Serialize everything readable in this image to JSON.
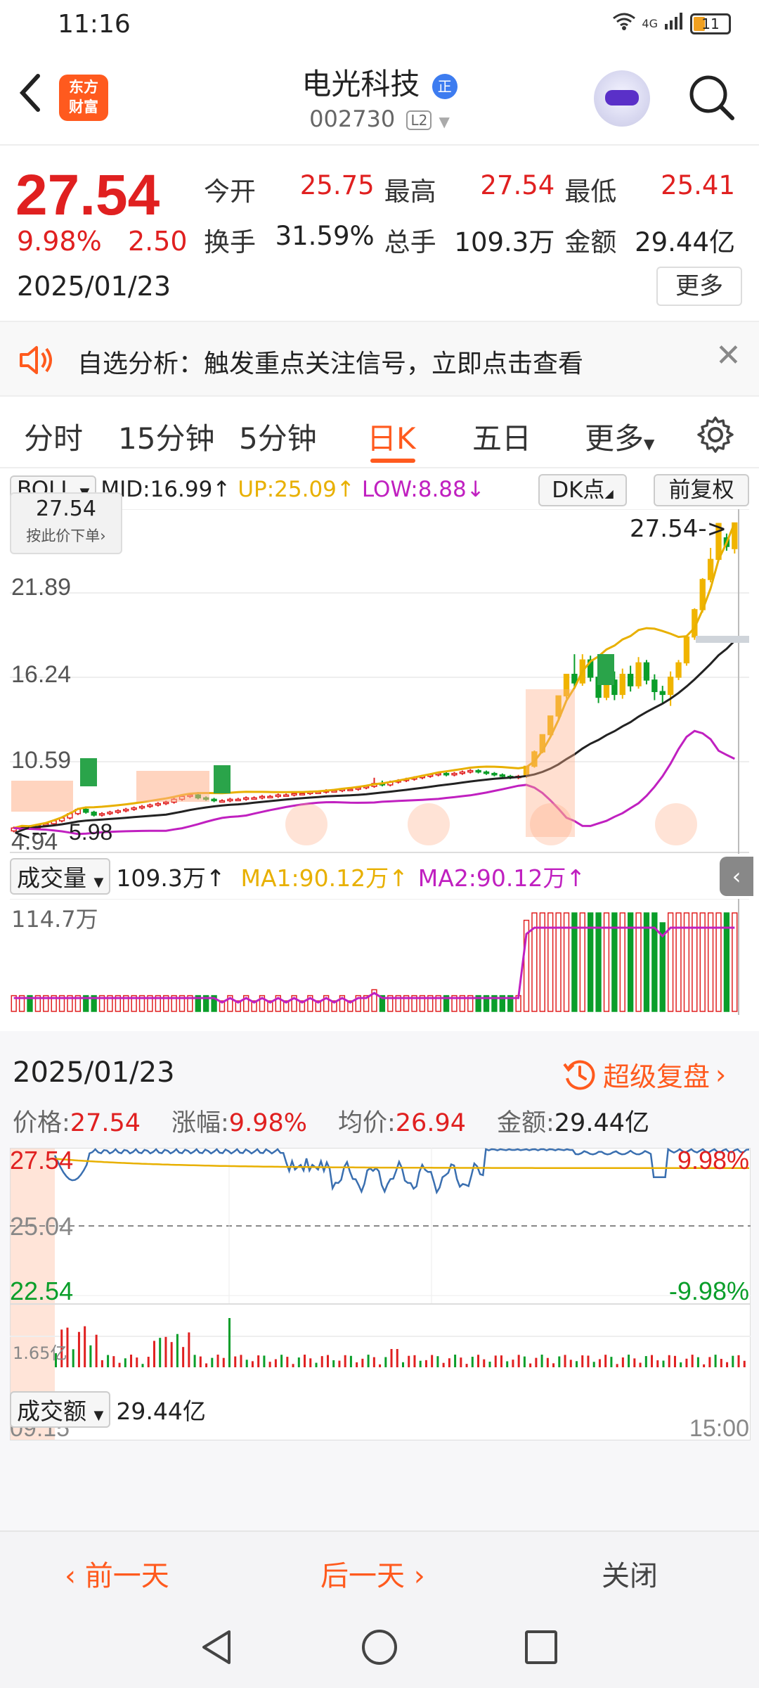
{
  "status_bar": {
    "time": "11:16",
    "network": "4G",
    "battery": "11"
  },
  "header": {
    "name": "电光科技",
    "badge": "正",
    "code": "002730",
    "level": "L2",
    "logo_line1": "东方",
    "logo_line2": "财富"
  },
  "quote": {
    "price": "27.54",
    "change_pct": "9.98%",
    "change": "2.50",
    "date": "2025/01/23",
    "fields": [
      {
        "label": "今开",
        "value": "25.75",
        "color": "#e02020"
      },
      {
        "label": "最高",
        "value": "27.54",
        "color": "#e02020"
      },
      {
        "label": "最低",
        "value": "25.41",
        "color": "#e02020"
      },
      {
        "label": "换手",
        "value": "31.59%",
        "color": "#222222"
      },
      {
        "label": "总手",
        "value": "109.3万",
        "color": "#222222"
      },
      {
        "label": "金额",
        "value": "29.44亿",
        "color": "#222222"
      }
    ],
    "more": "更多"
  },
  "banner": {
    "text": "自选分析：触发重点关注信号，立即点击查看"
  },
  "tabs": {
    "items": [
      "分时",
      "15分钟",
      "5分钟",
      "日K",
      "五日",
      "更多"
    ],
    "active": "日K"
  },
  "indicator": {
    "name": "BOLL",
    "mid": "MID:16.99↑",
    "up": "UP:25.09↑",
    "low": "LOW:8.88↓",
    "dk": "DK点",
    "adj": "前复权"
  },
  "kchart": {
    "tip_price": "27.54",
    "tip_sub": "按此价下单",
    "last_label": "27.54->",
    "y_labels": [
      "21.89",
      "16.24",
      "10.59",
      "4.94"
    ],
    "low_label": "5.98",
    "colors": {
      "up": "#e02020",
      "yellow": "#f0b400",
      "green": "#0a9e2a",
      "mid": "#222222",
      "band": "#c020c0"
    },
    "candles": [
      {
        "o": 6.1,
        "c": 6.3,
        "h": 6.4,
        "l": 6.0
      },
      {
        "o": 6.2,
        "c": 6.4,
        "h": 6.5,
        "l": 6.1
      },
      {
        "o": 6.4,
        "c": 6.3,
        "h": 6.5,
        "l": 6.2
      },
      {
        "o": 6.3,
        "c": 6.5,
        "h": 6.6,
        "l": 6.2
      },
      {
        "o": 6.5,
        "c": 6.6,
        "h": 6.7,
        "l": 6.4
      },
      {
        "o": 6.6,
        "c": 6.8,
        "h": 6.9,
        "l": 6.5
      },
      {
        "o": 6.8,
        "c": 7.0,
        "h": 7.1,
        "l": 6.7
      },
      {
        "o": 7.0,
        "c": 7.3,
        "h": 7.4,
        "l": 6.9
      },
      {
        "o": 7.3,
        "c": 7.6,
        "h": 7.7,
        "l": 7.2
      },
      {
        "o": 7.6,
        "c": 7.4,
        "h": 7.8,
        "l": 7.3
      },
      {
        "o": 7.4,
        "c": 7.2,
        "h": 7.5,
        "l": 7.1
      },
      {
        "o": 7.2,
        "c": 7.3,
        "h": 7.4,
        "l": 7.1
      },
      {
        "o": 7.3,
        "c": 7.4,
        "h": 7.5,
        "l": 7.2
      },
      {
        "o": 7.4,
        "c": 7.5,
        "h": 7.6,
        "l": 7.3
      },
      {
        "o": 7.5,
        "c": 7.6,
        "h": 7.7,
        "l": 7.4
      },
      {
        "o": 7.6,
        "c": 7.7,
        "h": 7.8,
        "l": 7.5
      },
      {
        "o": 7.7,
        "c": 7.8,
        "h": 7.9,
        "l": 7.6
      },
      {
        "o": 7.8,
        "c": 7.9,
        "h": 8.0,
        "l": 7.7
      },
      {
        "o": 7.9,
        "c": 8.0,
        "h": 8.1,
        "l": 7.8
      },
      {
        "o": 8.0,
        "c": 8.1,
        "h": 8.2,
        "l": 7.9
      },
      {
        "o": 8.1,
        "c": 8.3,
        "h": 8.4,
        "l": 8.0
      },
      {
        "o": 8.3,
        "c": 8.5,
        "h": 8.6,
        "l": 8.2
      },
      {
        "o": 8.5,
        "c": 8.6,
        "h": 8.7,
        "l": 8.4
      },
      {
        "o": 8.6,
        "c": 8.4,
        "h": 8.8,
        "l": 8.3
      },
      {
        "o": 8.4,
        "c": 8.3,
        "h": 8.5,
        "l": 8.2
      },
      {
        "o": 8.3,
        "c": 8.2,
        "h": 8.4,
        "l": 8.1
      },
      {
        "o": 8.2,
        "c": 8.2,
        "h": 8.3,
        "l": 8.1
      },
      {
        "o": 8.2,
        "c": 8.3,
        "h": 8.4,
        "l": 8.1
      },
      {
        "o": 8.3,
        "c": 8.3,
        "h": 8.4,
        "l": 8.2
      },
      {
        "o": 8.3,
        "c": 8.4,
        "h": 8.5,
        "l": 8.2
      },
      {
        "o": 8.4,
        "c": 8.4,
        "h": 8.5,
        "l": 8.3
      },
      {
        "o": 8.4,
        "c": 8.5,
        "h": 8.6,
        "l": 8.3
      },
      {
        "o": 8.5,
        "c": 8.5,
        "h": 8.6,
        "l": 8.4
      },
      {
        "o": 8.5,
        "c": 8.6,
        "h": 8.7,
        "l": 8.4
      },
      {
        "o": 8.6,
        "c": 8.6,
        "h": 8.7,
        "l": 8.5
      },
      {
        "o": 8.6,
        "c": 8.7,
        "h": 8.8,
        "l": 8.5
      },
      {
        "o": 8.7,
        "c": 8.7,
        "h": 8.8,
        "l": 8.6
      },
      {
        "o": 8.7,
        "c": 8.8,
        "h": 8.9,
        "l": 8.6
      },
      {
        "o": 8.8,
        "c": 8.8,
        "h": 8.9,
        "l": 8.7
      },
      {
        "o": 8.8,
        "c": 8.9,
        "h": 9.0,
        "l": 8.7
      },
      {
        "o": 8.9,
        "c": 8.9,
        "h": 9.0,
        "l": 8.8
      },
      {
        "o": 8.9,
        "c": 9.0,
        "h": 9.1,
        "l": 8.8
      },
      {
        "o": 9.0,
        "c": 9.0,
        "h": 9.1,
        "l": 8.9
      },
      {
        "o": 9.0,
        "c": 9.1,
        "h": 9.2,
        "l": 8.9
      },
      {
        "o": 9.1,
        "c": 9.2,
        "h": 9.3,
        "l": 9.0
      },
      {
        "o": 9.2,
        "c": 9.4,
        "h": 9.8,
        "l": 9.1
      },
      {
        "o": 9.4,
        "c": 9.3,
        "h": 9.6,
        "l": 9.2
      },
      {
        "o": 9.3,
        "c": 9.5,
        "h": 9.6,
        "l": 9.2
      },
      {
        "o": 9.5,
        "c": 9.6,
        "h": 9.7,
        "l": 9.4
      },
      {
        "o": 9.6,
        "c": 9.7,
        "h": 9.8,
        "l": 9.5
      },
      {
        "o": 9.7,
        "c": 9.8,
        "h": 9.9,
        "l": 9.6
      },
      {
        "o": 9.8,
        "c": 9.9,
        "h": 10.0,
        "l": 9.7
      },
      {
        "o": 9.9,
        "c": 10.0,
        "h": 10.1,
        "l": 9.8
      },
      {
        "o": 10.0,
        "c": 10.1,
        "h": 10.2,
        "l": 9.9
      },
      {
        "o": 10.1,
        "c": 10.0,
        "h": 10.2,
        "l": 9.9
      },
      {
        "o": 10.0,
        "c": 10.1,
        "h": 10.2,
        "l": 9.9
      },
      {
        "o": 10.1,
        "c": 10.2,
        "h": 10.3,
        "l": 10.0
      },
      {
        "o": 10.2,
        "c": 10.3,
        "h": 10.4,
        "l": 10.1
      },
      {
        "o": 10.3,
        "c": 10.2,
        "h": 10.4,
        "l": 10.1
      },
      {
        "o": 10.2,
        "c": 10.1,
        "h": 10.3,
        "l": 10.0
      },
      {
        "o": 10.1,
        "c": 10.0,
        "h": 10.2,
        "l": 9.9
      },
      {
        "o": 10.0,
        "c": 9.9,
        "h": 10.1,
        "l": 9.8
      },
      {
        "o": 9.9,
        "c": 9.8,
        "h": 10.0,
        "l": 9.7
      },
      {
        "o": 9.8,
        "c": 9.9,
        "h": 10.0,
        "l": 9.7
      },
      {
        "o": 9.9,
        "c": 10.6,
        "h": 10.6,
        "l": 9.8
      },
      {
        "o": 10.6,
        "c": 11.6,
        "h": 11.7,
        "l": 10.5
      },
      {
        "o": 11.6,
        "c": 12.8,
        "h": 12.8,
        "l": 11.5
      },
      {
        "o": 12.8,
        "c": 14.1,
        "h": 14.1,
        "l": 12.6
      },
      {
        "o": 14.1,
        "c": 15.5,
        "h": 15.5,
        "l": 13.9
      },
      {
        "o": 15.5,
        "c": 17.0,
        "h": 17.0,
        "l": 15.3
      },
      {
        "o": 17.0,
        "c": 16.4,
        "h": 18.4,
        "l": 16.0
      },
      {
        "o": 16.4,
        "c": 18.0,
        "h": 18.4,
        "l": 16.2
      },
      {
        "o": 18.0,
        "c": 16.8,
        "h": 18.3,
        "l": 16.5
      },
      {
        "o": 16.8,
        "c": 15.4,
        "h": 17.2,
        "l": 15.0
      },
      {
        "o": 15.4,
        "c": 16.6,
        "h": 17.0,
        "l": 15.2
      },
      {
        "o": 16.6,
        "c": 15.6,
        "h": 17.2,
        "l": 15.2
      },
      {
        "o": 15.6,
        "c": 17.0,
        "h": 17.4,
        "l": 15.3
      },
      {
        "o": 17.0,
        "c": 16.2,
        "h": 17.6,
        "l": 15.8
      },
      {
        "o": 16.2,
        "c": 17.8,
        "h": 18.2,
        "l": 16.0
      },
      {
        "o": 17.8,
        "c": 16.6,
        "h": 18.0,
        "l": 16.3
      },
      {
        "o": 16.6,
        "c": 15.8,
        "h": 17.0,
        "l": 15.2
      },
      {
        "o": 15.8,
        "c": 15.6,
        "h": 16.2,
        "l": 15.0
      },
      {
        "o": 15.6,
        "c": 16.8,
        "h": 17.2,
        "l": 14.8
      },
      {
        "o": 16.8,
        "c": 17.8,
        "h": 18.0,
        "l": 16.6
      },
      {
        "o": 17.8,
        "c": 19.6,
        "h": 19.6,
        "l": 17.6
      },
      {
        "o": 19.6,
        "c": 21.5,
        "h": 21.6,
        "l": 19.4
      },
      {
        "o": 21.5,
        "c": 23.6,
        "h": 23.7,
        "l": 21.3
      },
      {
        "o": 23.6,
        "c": 25.0,
        "h": 25.8,
        "l": 23.4
      },
      {
        "o": 25.0,
        "c": 27.5,
        "h": 27.54,
        "l": 24.9
      },
      {
        "o": 26.5,
        "c": 25.9,
        "h": 26.8,
        "l": 25.6
      },
      {
        "o": 25.75,
        "c": 27.54,
        "h": 27.54,
        "l": 25.41
      }
    ]
  },
  "volume": {
    "label": "成交量",
    "value": "109.3万↑",
    "ma1": "MA1:90.12万↑",
    "ma2": "MA2:90.12万↑",
    "max_label": "114.7万"
  },
  "detail": {
    "date": "2025/01/23",
    "replay": "超级复盘",
    "price_label": "价格:",
    "price": "27.54",
    "pct_label": "涨幅:",
    "pct": "9.98%",
    "avg_label": "均价:",
    "avg": "26.94",
    "amt_label": "金额:",
    "amt": "29.44亿",
    "y_top": "27.54",
    "y_mid": "25.04",
    "y_bot": "22.54",
    "pct_top": "9.98%",
    "pct_bot": "-9.98%",
    "amount_label": "成交额",
    "amount_value": "29.44亿",
    "amount_max": "1.65亿",
    "t_start": "09:15",
    "t_end": "15:00"
  },
  "bottom": {
    "prev": "前一天",
    "next": "后一天",
    "close": "关闭"
  }
}
